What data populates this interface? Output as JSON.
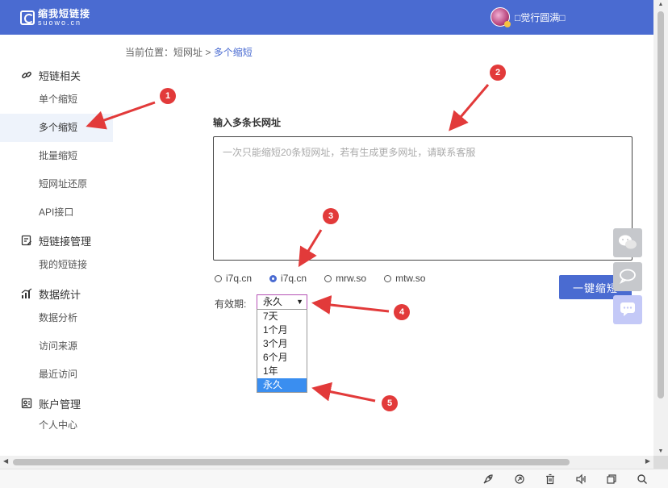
{
  "header": {
    "logo_cn": "缩我短链接",
    "logo_en": "suowo.cn",
    "username": "□觉行圆满□"
  },
  "breadcrumb": {
    "prefix": "当前位置：",
    "parent": "短网址",
    "separator": " > ",
    "current": "多个缩短"
  },
  "sidebar": {
    "groups": [
      {
        "title": "短链相关",
        "icon": "link-icon",
        "items": [
          "单个缩短",
          "多个缩短",
          "批量缩短",
          "短网址还原",
          "API接口"
        ]
      },
      {
        "title": "短链接管理",
        "icon": "manage-icon",
        "items": [
          "我的短链接"
        ]
      },
      {
        "title": "数据统计",
        "icon": "bar-chart-icon",
        "items": [
          "数据分析",
          "访问来源",
          "最近访问"
        ]
      },
      {
        "title": "账户管理",
        "icon": "account-icon",
        "items": [
          "个人中心"
        ]
      }
    ],
    "active_item": "多个缩短"
  },
  "form": {
    "title": "输入多条长网址",
    "placeholder": "一次只能缩短20条短网址，若有生成更多网址，请联系客服",
    "domains": [
      "i7q.cn",
      "i7q.cn",
      "mrw.so",
      "mtw.so"
    ],
    "selected_domain_index": 1,
    "submit_label": "一键缩短",
    "validity_label": "有效期:",
    "validity_selected": "永久",
    "validity_options": [
      "7天",
      "1个月",
      "3个月",
      "6个月",
      "1年",
      "永久"
    ]
  },
  "markers": [
    "1",
    "2",
    "3",
    "4",
    "5"
  ],
  "colors": {
    "header": "#4a6bd1",
    "accent": "#4a6bd1",
    "marker": "#e23a3a",
    "highlight": "#3a8ef0"
  }
}
